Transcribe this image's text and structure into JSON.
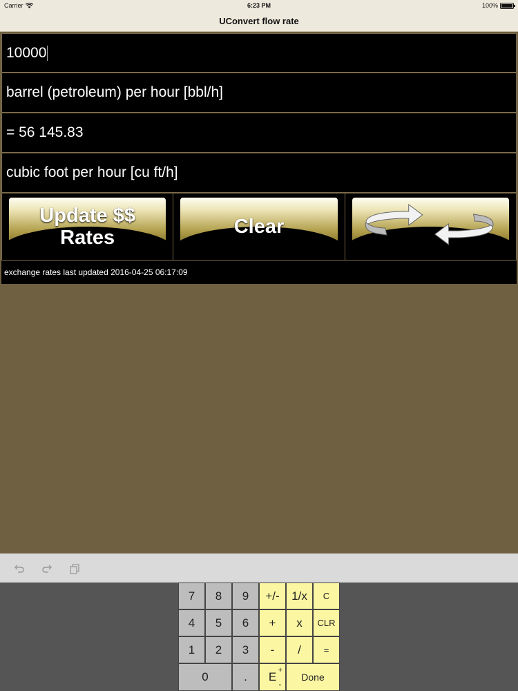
{
  "status_bar": {
    "carrier": "Carrier",
    "time": "6:23 PM",
    "battery": "100%"
  },
  "nav": {
    "title": "UConvert flow rate"
  },
  "input_value": "10000",
  "from_unit": "barrel (petroleum) per hour [bbl/h]",
  "result": "= 56 145.83",
  "to_unit": "cubic foot per hour [cu ft/h]",
  "buttons": {
    "update_line1": "Update $$",
    "update_line2": "Rates",
    "clear": "Clear",
    "swap_icon": "swap-arrows-icon"
  },
  "info": "exchange rates last updated 2016-04-25 06:17:09",
  "accessory": {
    "undo_icon": "undo-icon",
    "redo_icon": "redo-icon",
    "paste_icon": "paste-icon"
  },
  "keypad": {
    "k7": "7",
    "k8": "8",
    "k9": "9",
    "plusminus": "+/-",
    "recip": "1/x",
    "c": "C",
    "k4": "4",
    "k5": "5",
    "k6": "6",
    "plus": "+",
    "times": "x",
    "clr": "CLR",
    "k1": "1",
    "k2": "2",
    "k3": "3",
    "minus": "-",
    "divide": "/",
    "equals": "=",
    "k0": "0",
    "dot": ".",
    "exp": "E",
    "exp_sup": "+",
    "exp_sub": "-",
    "done": "Done"
  },
  "colors": {
    "background": "#6e6040",
    "accent_gold": "#b4a24f",
    "key_op": "#fbf6a2",
    "key_num": "#bdbdbd"
  }
}
